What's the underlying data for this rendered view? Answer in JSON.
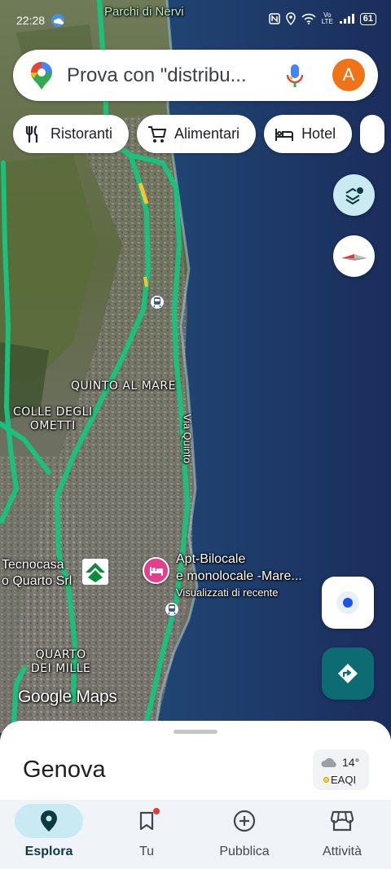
{
  "status_bar": {
    "time": "22:28",
    "signal_text": "Vo LTE",
    "battery": "61"
  },
  "search": {
    "placeholder": "Prova con \"distribu..."
  },
  "account": {
    "initial": "A",
    "color": "#f07317"
  },
  "chips": [
    {
      "label": "Ristoranti",
      "icon": "restaurant-icon"
    },
    {
      "label": "Alimentari",
      "icon": "shopping-cart-icon"
    },
    {
      "label": "Hotel",
      "icon": "hotel-bed-icon"
    }
  ],
  "map": {
    "labels": {
      "parchi": "Parchi di Nervi",
      "quinto": "QUINTO AL MARE",
      "colle_1": "COLLE DEGLI",
      "colle_2": "OMETTI",
      "via_quinto": "Via Quinto",
      "tecnocasa_1": "Tecnocasa",
      "tecnocasa_2": "o Quarto Srl",
      "apt_1": "Apt-Bilocale",
      "apt_2": "e monolocale -Mare...",
      "apt_sub": "Visualizzati di recente",
      "quarto_1": "QUARTO",
      "quarto_2": "DEI MILLE"
    },
    "watermark": "Google Maps"
  },
  "sheet": {
    "title": "Genova",
    "weather": {
      "temp": "14°",
      "aqi": "EAQI"
    }
  },
  "nav": [
    {
      "label": "Esplora",
      "icon": "explore-pin-icon",
      "active": true
    },
    {
      "label": "Tu",
      "icon": "bookmark-icon",
      "active": false
    },
    {
      "label": "Pubblica",
      "icon": "add-circle-icon",
      "active": false
    },
    {
      "label": "Attività",
      "icon": "storefront-icon",
      "active": false
    }
  ],
  "colors": {
    "accent_teal": "#0d6b74",
    "nav_active_bg": "#c9e9f3",
    "traffic_green": "#19c27c",
    "hotel_pin": "#e43f8c"
  }
}
